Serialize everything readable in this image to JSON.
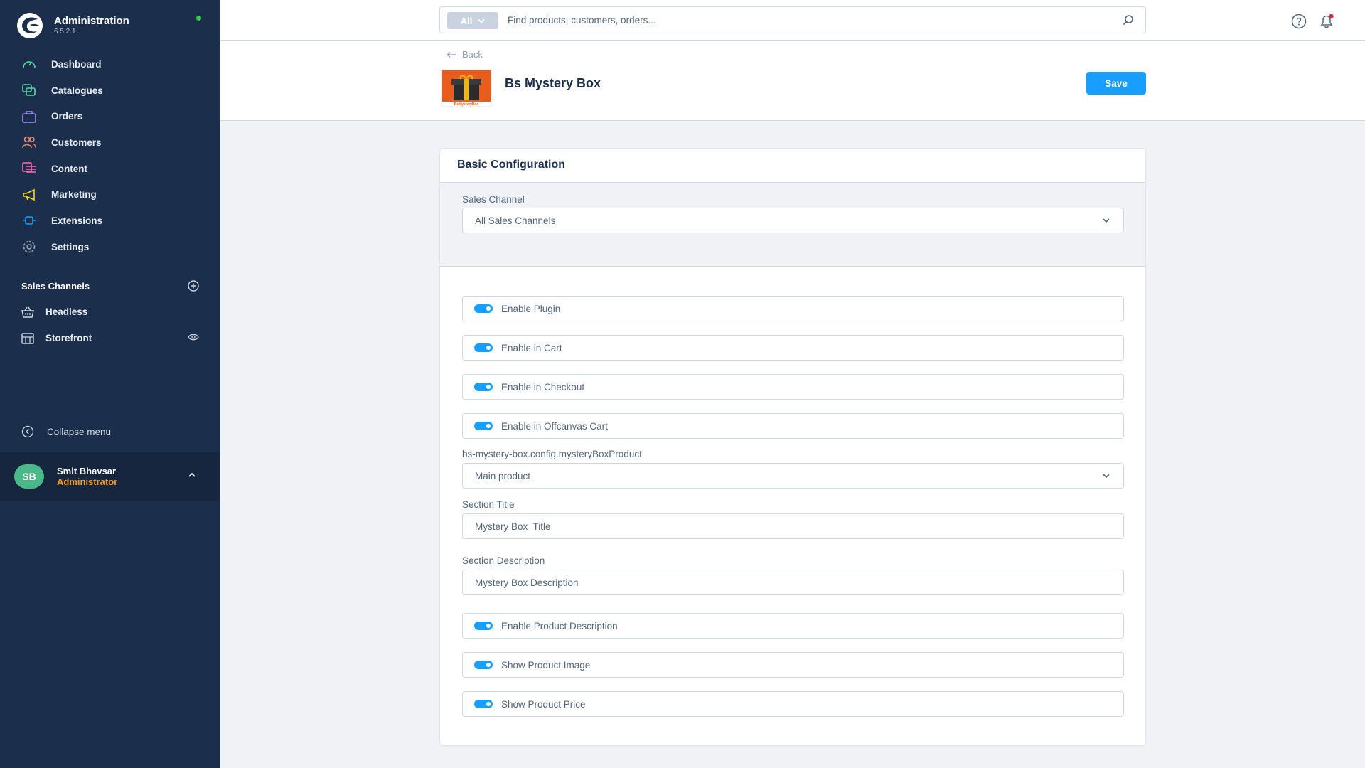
{
  "app": {
    "title": "Administration",
    "version": "6.5.2.1",
    "status_color": "#37d046"
  },
  "sidebar": {
    "nav": [
      {
        "label": "Dashboard",
        "icon": "dashboard-icon",
        "color": "#57d9a3"
      },
      {
        "label": "Catalogues",
        "icon": "catalogue-icon",
        "color": "#57d9a3"
      },
      {
        "label": "Orders",
        "icon": "orders-icon",
        "color": "#a092f0"
      },
      {
        "label": "Customers",
        "icon": "customers-icon",
        "color": "#f88962"
      },
      {
        "label": "Content",
        "icon": "content-icon",
        "color": "#ff68b4"
      },
      {
        "label": "Marketing",
        "icon": "marketing-icon",
        "color": "#ffd700"
      },
      {
        "label": "Extensions",
        "icon": "extensions-icon",
        "color": "#189eff"
      },
      {
        "label": "Settings",
        "icon": "settings-icon",
        "color": "#9aa8b5"
      }
    ],
    "sales_channels_title": "Sales Channels",
    "channels": [
      {
        "label": "Headless",
        "icon": "basket-icon"
      },
      {
        "label": "Storefront",
        "icon": "storefront-icon"
      }
    ],
    "collapse_label": "Collapse menu",
    "user": {
      "initials": "SB",
      "name": "Smit Bhavsar",
      "role": "Administrator"
    }
  },
  "topbar": {
    "search_type": "All",
    "search_placeholder": "Find products, customers, orders..."
  },
  "page": {
    "back_label": "Back",
    "product_title": "Bs Mystery Box",
    "thumb_brand": "BsMysteryBox",
    "save_label": "Save"
  },
  "card": {
    "title": "Basic Configuration",
    "sales_channel_label": "Sales Channel",
    "sales_channel_value": "All Sales Channels",
    "toggles_top": [
      {
        "label": "Enable Plugin",
        "on": true
      },
      {
        "label": "Enable in Cart",
        "on": true
      },
      {
        "label": "Enable in Checkout",
        "on": true
      },
      {
        "label": "Enable in Offcanvas Cart",
        "on": true
      }
    ],
    "product_field_label": "bs-mystery-box.config.mysteryBoxProduct",
    "product_field_value": "Main product",
    "section_title_label": "Section Title",
    "section_title_value": "Mystery Box  Title",
    "section_desc_label": "Section Description",
    "section_desc_value": "Mystery Box Description",
    "toggles_bottom": [
      {
        "label": "Enable Product Description",
        "on": true
      },
      {
        "label": "Show Product Image",
        "on": true
      },
      {
        "label": "Show Product Price",
        "on": true
      }
    ]
  },
  "colors": {
    "sidebar_bg": "#1b2e4b",
    "accent": "#189eff",
    "role": "#f8981d"
  }
}
